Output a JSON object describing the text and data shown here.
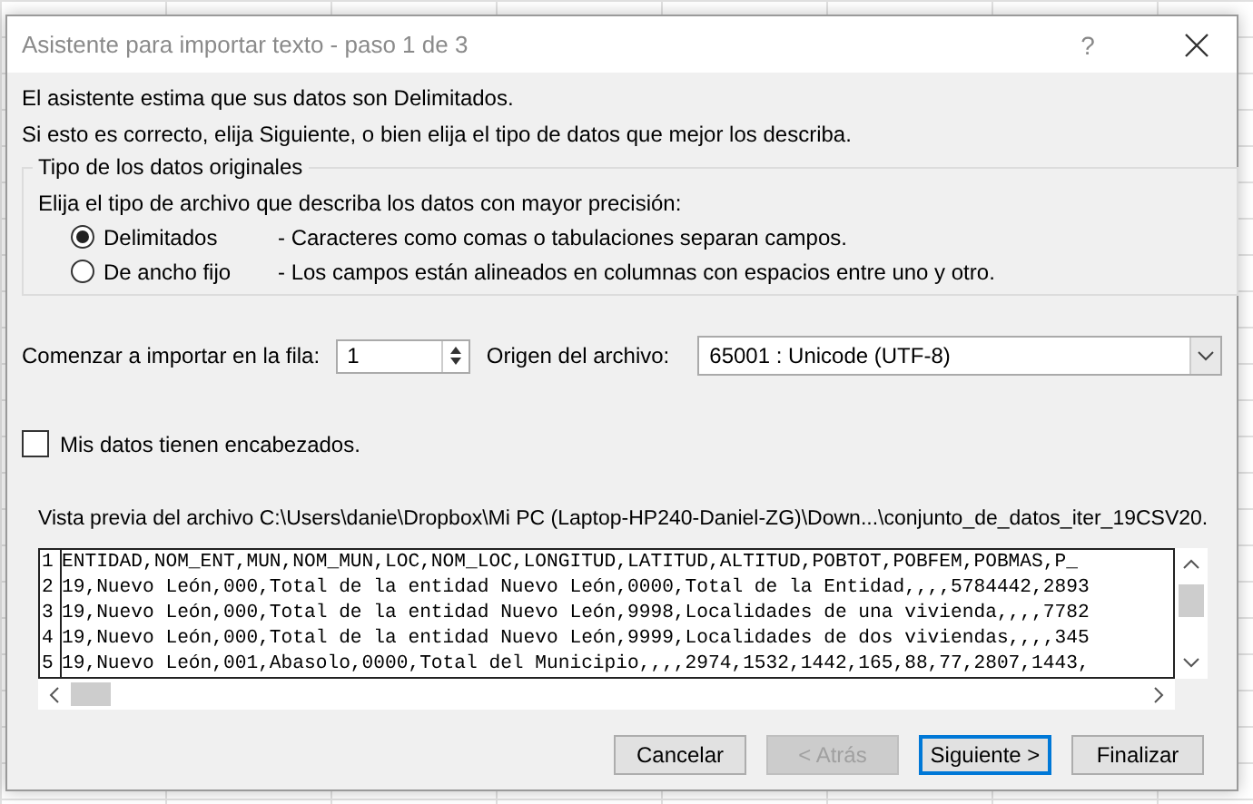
{
  "window": {
    "title": "Asistente para importar texto - paso 1 de 3",
    "help": "?"
  },
  "intro": [
    "El asistente estima que sus datos son Delimitados.",
    "Si esto es correcto, elija Siguiente, o bien elija el tipo de datos que mejor los describa."
  ],
  "data_type_group": {
    "title": "Tipo de los datos originales",
    "prompt": "Elija el tipo de archivo que describa los datos con mayor precisión:",
    "options": [
      {
        "label": "Delimitados",
        "description": "- Caracteres como comas o tabulaciones separan campos.",
        "selected": true
      },
      {
        "label": "De ancho fijo",
        "description": "- Los campos están alineados en columnas con espacios entre uno y otro.",
        "selected": false
      }
    ]
  },
  "start_row": {
    "label": "Comenzar a importar en la fila:",
    "value": "1"
  },
  "file_origin": {
    "label": "Origen del archivo:",
    "value": "65001 : Unicode (UTF-8)"
  },
  "headers_checkbox": {
    "label": "Mis datos tienen encabezados.",
    "checked": false
  },
  "preview": {
    "label": "Vista previa del archivo C:\\Users\\danie\\Dropbox\\Mi PC (Laptop-HP240-Daniel-ZG)\\Down...\\conjunto_de_datos_iter_19CSV20.",
    "rows": [
      {
        "number": "1",
        "text": "ENTIDAD,NOM_ENT,MUN,NOM_MUN,LOC,NOM_LOC,LONGITUD,LATITUD,ALTITUD,POBTOT,POBFEM,POBMAS,P_"
      },
      {
        "number": "2",
        "text": "19,Nuevo León,000,Total de la entidad Nuevo León,0000,Total de la Entidad,,,,5784442,2893"
      },
      {
        "number": "3",
        "text": "19,Nuevo León,000,Total de la entidad Nuevo León,9998,Localidades de una vivienda,,,,7782"
      },
      {
        "number": "4",
        "text": "19,Nuevo León,000,Total de la entidad Nuevo León,9999,Localidades de dos viviendas,,,,345"
      },
      {
        "number": "5",
        "text": "19,Nuevo León,001,Abasolo,0000,Total del Municipio,,,,2974,1532,1442,165,88,77,2807,1443,"
      }
    ]
  },
  "buttons": [
    {
      "label": "Cancelar",
      "disabled": false,
      "default": false
    },
    {
      "label": "< Atrás",
      "disabled": true,
      "default": false
    },
    {
      "label": "Siguiente >",
      "disabled": false,
      "default": true
    },
    {
      "label": "Finalizar",
      "disabled": false,
      "default": false
    }
  ]
}
